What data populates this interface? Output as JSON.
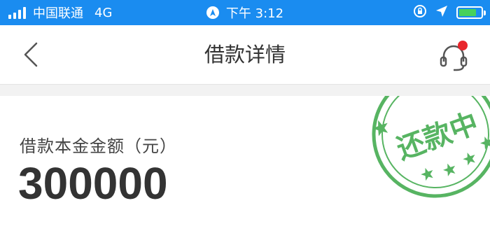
{
  "status_bar": {
    "carrier": "中国联通",
    "network": "4G",
    "time": "下午 3:12",
    "battery_level": 0.8
  },
  "nav": {
    "title": "借款详情",
    "icons": {
      "back": "back-chevron-icon",
      "service": "customer-service-icon"
    },
    "notification_dot_color": "#e8262c"
  },
  "loan": {
    "principal_label": "借款本金金额（元）",
    "principal_value": "300000"
  },
  "stamp": {
    "text": "还款中",
    "color": "#3aa847"
  },
  "colors": {
    "status_bar": "#1a8cf0",
    "battery": "#46d15c"
  }
}
